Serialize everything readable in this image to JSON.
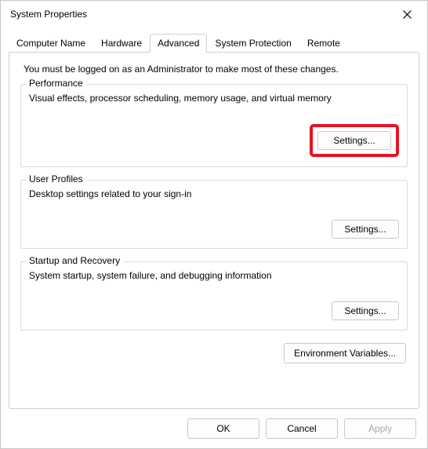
{
  "window": {
    "title": "System Properties"
  },
  "tabs": {
    "items": [
      {
        "label": "Computer Name"
      },
      {
        "label": "Hardware"
      },
      {
        "label": "Advanced"
      },
      {
        "label": "System Protection"
      },
      {
        "label": "Remote"
      }
    ],
    "active_index": 2
  },
  "panel": {
    "admin_note": "You must be logged on as an Administrator to make most of these changes.",
    "performance": {
      "legend": "Performance",
      "desc": "Visual effects, processor scheduling, memory usage, and virtual memory",
      "settings_label": "Settings..."
    },
    "user_profiles": {
      "legend": "User Profiles",
      "desc": "Desktop settings related to your sign-in",
      "settings_label": "Settings..."
    },
    "startup_recovery": {
      "legend": "Startup and Recovery",
      "desc": "System startup, system failure, and debugging information",
      "settings_label": "Settings..."
    },
    "env_vars_label": "Environment Variables..."
  },
  "footer": {
    "ok": "OK",
    "cancel": "Cancel",
    "apply": "Apply"
  }
}
